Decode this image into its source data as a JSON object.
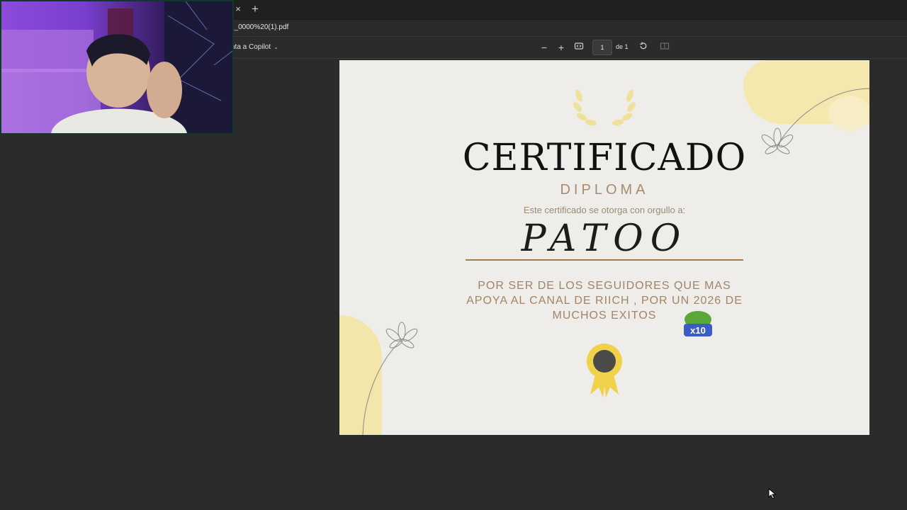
{
  "browser": {
    "tab_close": "×",
    "new_tab": "+",
    "url": "2_0000%20(1).pdf"
  },
  "pdf_toolbar": {
    "copilot_label": "nta a Copilot",
    "zoom_out": "−",
    "zoom_in": "+",
    "page_current": "1",
    "page_of": "de 1"
  },
  "certificate": {
    "title": "CERTIFICADO",
    "subtitle": "DIPLOMA",
    "intro": "Este certificado se otorga con orgullo a:",
    "name": "PATOO",
    "body": "POR SER DE LOS SEGUIDORES  QUE MAS\nAPOYA AL CANAL DE RIICH  , POR UN 2026  DE\nMUCHOS EXITOS",
    "emote_text": "x10"
  },
  "colors": {
    "app_bg": "#2b2b2b",
    "page_bg": "#eeede9",
    "accent_gold": "#f4e6a4",
    "text_brown": "#a28465"
  }
}
